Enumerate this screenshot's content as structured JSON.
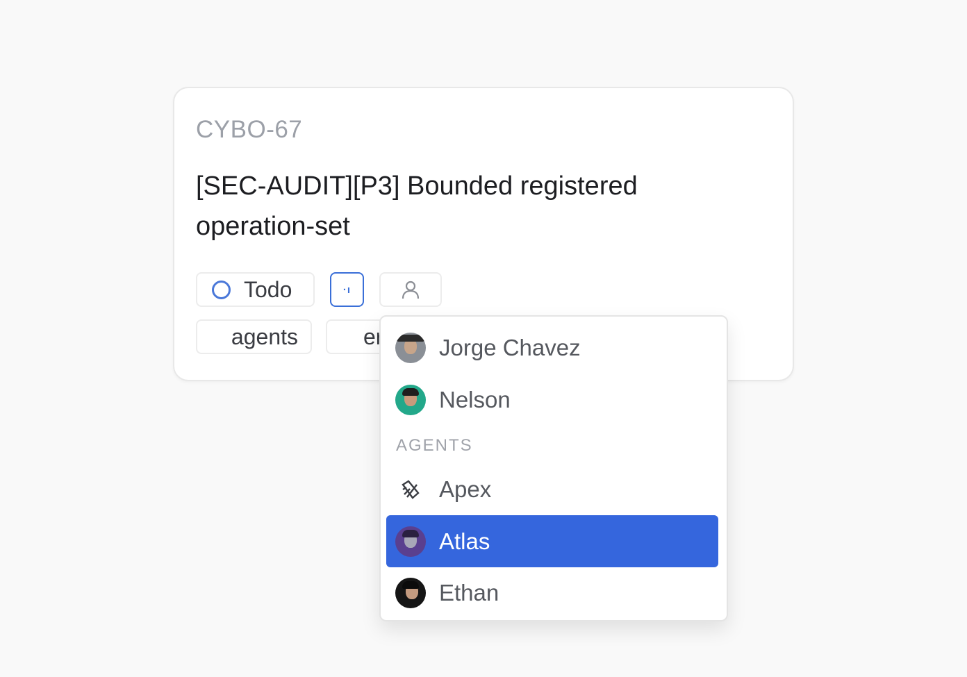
{
  "issue": {
    "id": "CYBO-67",
    "title": "[SEC-AUDIT][P3] Bounded registered operation-set",
    "status": "Todo",
    "priority_glyph": "·ı",
    "labels": [
      "agents",
      "er"
    ]
  },
  "assignee_menu": {
    "people": [
      {
        "name": "Jorge Chavez",
        "avatar": "jorge-avatar"
      },
      {
        "name": "Nelson",
        "avatar": "nelson-avatar"
      }
    ],
    "agents_section_label": "AGENTS",
    "agents": [
      {
        "name": "Apex",
        "avatar": "apex-logo-icon"
      },
      {
        "name": "Atlas",
        "avatar": "atlas-avatar",
        "selected": true
      },
      {
        "name": "Ethan",
        "avatar": "ethan-avatar"
      }
    ],
    "selected_color": "#3566dd"
  },
  "colors": {
    "status_ring": "#4a78d9",
    "priority_border": "#3a6fd8"
  }
}
